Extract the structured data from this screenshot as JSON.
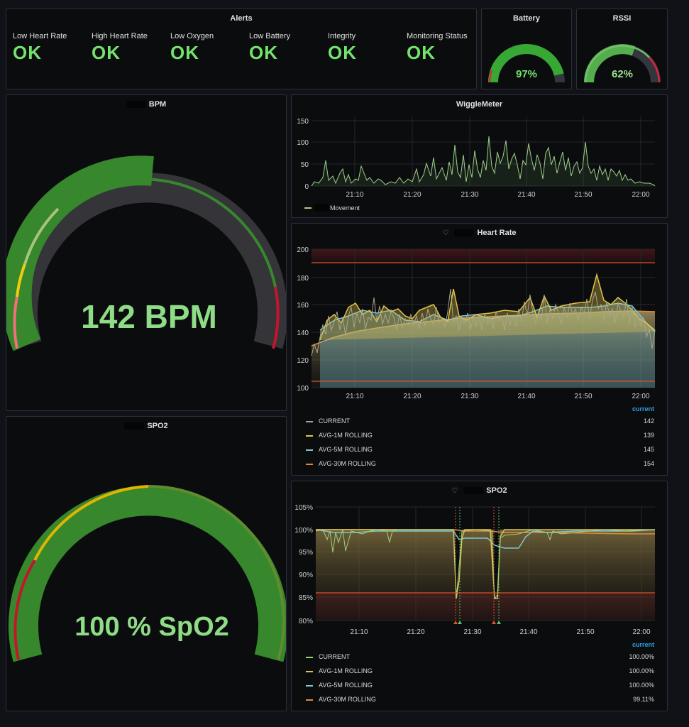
{
  "alerts": {
    "title": "Alerts",
    "items": [
      {
        "label": "Low Heart Rate",
        "value": "OK"
      },
      {
        "label": "High Heart Rate",
        "value": "OK"
      },
      {
        "label": "Low Oxygen",
        "value": "OK"
      },
      {
        "label": "Low Battery",
        "value": "OK"
      },
      {
        "label": "Integrity",
        "value": "OK"
      },
      {
        "label": "Monitoring Status",
        "value": "OK"
      }
    ],
    "ok_color": "#73e36d"
  },
  "battery": {
    "title": "Battery",
    "value_text": "97%",
    "fraction": 0.97
  },
  "rssi": {
    "title": "RSSI",
    "value_text": "62%",
    "fraction": 0.62
  },
  "bpm": {
    "title": "BPM",
    "value_text": "142 BPM",
    "fraction": 0.47
  },
  "spo2_gauge": {
    "title": "SPO2",
    "value_text": "100 % SpO2",
    "fraction": 1.0
  },
  "wiggle": {
    "title": "WiggleMeter",
    "y_ticks": [
      "150",
      "100",
      "50",
      "0"
    ],
    "x_ticks": [
      "21:10",
      "21:20",
      "21:30",
      "21:40",
      "21:50",
      "22:00"
    ],
    "legend": "Movement"
  },
  "heart": {
    "title": "Heart Rate",
    "y_ticks": [
      "200",
      "180",
      "160",
      "140",
      "120",
      "100"
    ],
    "x_ticks": [
      "21:10",
      "21:20",
      "21:30",
      "21:40",
      "21:50",
      "22:00"
    ],
    "legend_header": "current",
    "legend": [
      {
        "name": "CURRENT",
        "value": "142",
        "color": "#a0a0a0"
      },
      {
        "name": "AVG-1M ROLLING",
        "value": "139",
        "color": "#e0c34a"
      },
      {
        "name": "AVG-5M ROLLING",
        "value": "145",
        "color": "#7fc7d2"
      },
      {
        "name": "AVG-30M ROLLING",
        "value": "154",
        "color": "#e08a3c"
      }
    ]
  },
  "spo2": {
    "title": "SPO2",
    "y_ticks": [
      "105%",
      "100%",
      "95%",
      "90%",
      "85%",
      "80%"
    ],
    "x_ticks": [
      "21:10",
      "21:20",
      "21:30",
      "21:40",
      "21:50",
      "22:00"
    ],
    "legend_header": "current",
    "legend": [
      {
        "name": "CURRENT",
        "value": "100.00%",
        "color": "#9fd17a"
      },
      {
        "name": "AVG-1M ROLLING",
        "value": "100.00%",
        "color": "#e0c34a"
      },
      {
        "name": "AVG-5M ROLLING",
        "value": "100.00%",
        "color": "#7fc7d2"
      },
      {
        "name": "AVG-30M ROLLING",
        "value": "99.11%",
        "color": "#e08a3c"
      }
    ]
  }
}
